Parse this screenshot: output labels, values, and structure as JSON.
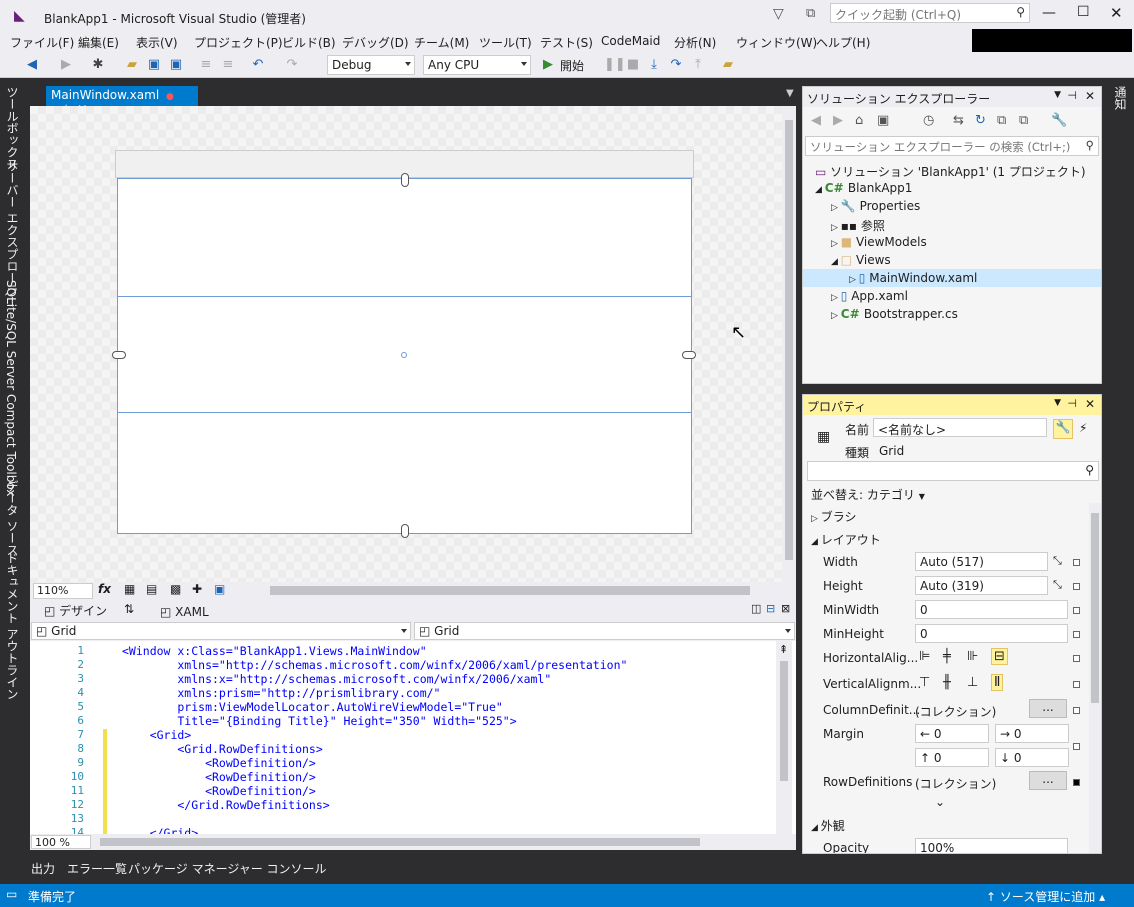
{
  "title": "BlankApp1 - Microsoft Visual Studio (管理者)",
  "quick_launch": {
    "placeholder": "クイック起動 (Ctrl+Q)"
  },
  "menu": [
    "ファイル(F)",
    "編集(E)",
    "表示(V)",
    "プロジェクト(P)",
    "ビルド(B)",
    "デバッグ(D)",
    "チーム(M)",
    "ツール(T)",
    "テスト(S)",
    "CodeMaid",
    "分析(N)",
    "ウィンドウ(W)",
    "ヘルプ(H)"
  ],
  "toolbar": {
    "config": "Debug",
    "platform": "Any CPU",
    "start": "開始"
  },
  "left_tabs": [
    "ツールボックス",
    "サーバー エクスプローラー",
    "SQLite/SQL Server Compact Toolbox",
    "データ ソース",
    "ドキュメント アウトライン"
  ],
  "doc_tab": {
    "name": "MainWindow.xaml"
  },
  "designer": {
    "zoom": "110%",
    "design_tab": "デザイン",
    "xaml_tab": "XAML",
    "left_combo": "Grid",
    "right_combo": "Grid"
  },
  "code_lines": [
    {
      "n": "1",
      "t": "<Window x:Class=\"BlankApp1.Views.MainWindow\""
    },
    {
      "n": "2",
      "t": "        xmlns=\"http://schemas.microsoft.com/winfx/2006/xaml/presentation\""
    },
    {
      "n": "3",
      "t": "        xmlns:x=\"http://schemas.microsoft.com/winfx/2006/xaml\""
    },
    {
      "n": "4",
      "t": "        xmlns:prism=\"http://prismlibrary.com/\""
    },
    {
      "n": "5",
      "t": "        prism:ViewModelLocator.AutoWireViewModel=\"True\""
    },
    {
      "n": "6",
      "t": "        Title=\"{Binding Title}\" Height=\"350\" Width=\"525\">"
    },
    {
      "n": "7",
      "t": "    <Grid>"
    },
    {
      "n": "8",
      "t": "        <Grid.RowDefinitions>"
    },
    {
      "n": "9",
      "t": "            <RowDefinition/>"
    },
    {
      "n": "10",
      "t": "            <RowDefinition/>"
    },
    {
      "n": "11",
      "t": "            <RowDefinition/>"
    },
    {
      "n": "12",
      "t": "        </Grid.RowDefinitions>"
    },
    {
      "n": "13",
      "t": ""
    },
    {
      "n": "14",
      "t": "    </Grid>"
    }
  ],
  "editor_zoom": "100 %",
  "bottom_tabs": [
    "出力",
    "エラー一覧",
    "パッケージ マネージャー コンソール"
  ],
  "status": {
    "left": "準備完了",
    "right": "ソース管理に追加"
  },
  "solution_explorer": {
    "title": "ソリューション エクスプローラー",
    "search_placeholder": "ソリューション エクスプローラー の検索 (Ctrl+;)",
    "items": [
      {
        "label": "ソリューション 'BlankApp1' (1 プロジェクト)"
      },
      {
        "label": "BlankApp1"
      },
      {
        "label": "Properties"
      },
      {
        "label": "参照"
      },
      {
        "label": "ViewModels"
      },
      {
        "label": "Views"
      },
      {
        "label": "MainWindow.xaml"
      },
      {
        "label": "App.xaml"
      },
      {
        "label": "Bootstrapper.cs"
      }
    ]
  },
  "properties": {
    "title": "プロパティ",
    "name_label": "名前",
    "name_value": "<名前なし>",
    "type_label": "種類",
    "type_value": "Grid",
    "sort": "並べ替え: カテゴリ",
    "cat_brush": "ブラシ",
    "cat_layout": "レイアウト",
    "cat_appearance": "外観",
    "rows": [
      {
        "label": "Width",
        "value": "Auto (517)"
      },
      {
        "label": "Height",
        "value": "Auto (319)"
      },
      {
        "label": "MinWidth",
        "value": "0"
      },
      {
        "label": "MinHeight",
        "value": "0"
      },
      {
        "label": "HorizontalAlig...",
        "value": ""
      },
      {
        "label": "VerticalAlignm...",
        "value": ""
      },
      {
        "label": "ColumnDefinit...",
        "value": "(コレクション)"
      },
      {
        "label": "Margin",
        "value": ""
      },
      {
        "label": "RowDefinitions",
        "value": "(コレクション)"
      },
      {
        "label": "Opacity",
        "value": "100%"
      }
    ],
    "margin": [
      "0",
      "0",
      "0",
      "0"
    ],
    "ellipsis": "..."
  },
  "notify_tab": "通知"
}
